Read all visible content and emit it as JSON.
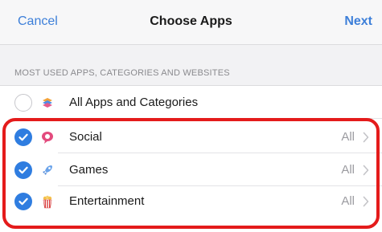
{
  "navbar": {
    "cancel_label": "Cancel",
    "title": "Choose Apps",
    "next_label": "Next"
  },
  "section_header": "MOST USED APPS, CATEGORIES AND WEBSITES",
  "rows": [
    {
      "label": "All Apps and Categories",
      "value": "",
      "checked": false,
      "icon": "stack-icon"
    },
    {
      "label": "Social",
      "value": "All",
      "checked": true,
      "icon": "chat-bubble-icon"
    },
    {
      "label": "Games",
      "value": "All",
      "checked": true,
      "icon": "rocket-icon"
    },
    {
      "label": "Entertainment",
      "value": "All",
      "checked": true,
      "icon": "popcorn-icon"
    }
  ],
  "colors": {
    "accent": "#3d7fd9",
    "checkmark_fill": "#2f7de0",
    "highlight_border": "#e41b1b"
  }
}
